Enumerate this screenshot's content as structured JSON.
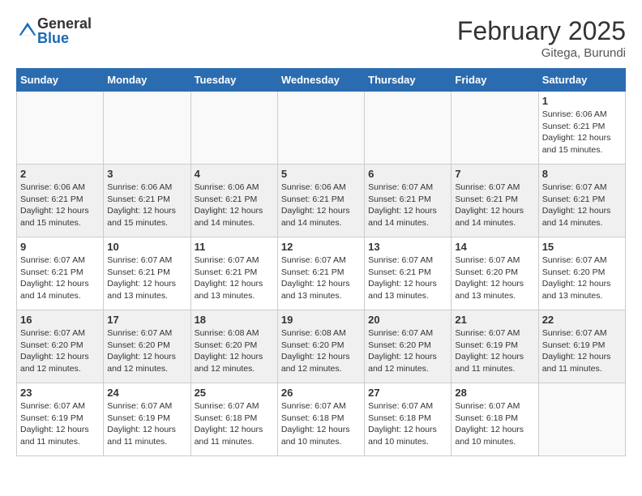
{
  "logo": {
    "general": "General",
    "blue": "Blue"
  },
  "title": {
    "month": "February 2025",
    "location": "Gitega, Burundi"
  },
  "weekdays": [
    "Sunday",
    "Monday",
    "Tuesday",
    "Wednesday",
    "Thursday",
    "Friday",
    "Saturday"
  ],
  "weeks": [
    [
      {
        "day": "",
        "info": ""
      },
      {
        "day": "",
        "info": ""
      },
      {
        "day": "",
        "info": ""
      },
      {
        "day": "",
        "info": ""
      },
      {
        "day": "",
        "info": ""
      },
      {
        "day": "",
        "info": ""
      },
      {
        "day": "1",
        "info": "Sunrise: 6:06 AM\nSunset: 6:21 PM\nDaylight: 12 hours\nand 15 minutes."
      }
    ],
    [
      {
        "day": "2",
        "info": "Sunrise: 6:06 AM\nSunset: 6:21 PM\nDaylight: 12 hours\nand 15 minutes."
      },
      {
        "day": "3",
        "info": "Sunrise: 6:06 AM\nSunset: 6:21 PM\nDaylight: 12 hours\nand 15 minutes."
      },
      {
        "day": "4",
        "info": "Sunrise: 6:06 AM\nSunset: 6:21 PM\nDaylight: 12 hours\nand 14 minutes."
      },
      {
        "day": "5",
        "info": "Sunrise: 6:06 AM\nSunset: 6:21 PM\nDaylight: 12 hours\nand 14 minutes."
      },
      {
        "day": "6",
        "info": "Sunrise: 6:07 AM\nSunset: 6:21 PM\nDaylight: 12 hours\nand 14 minutes."
      },
      {
        "day": "7",
        "info": "Sunrise: 6:07 AM\nSunset: 6:21 PM\nDaylight: 12 hours\nand 14 minutes."
      },
      {
        "day": "8",
        "info": "Sunrise: 6:07 AM\nSunset: 6:21 PM\nDaylight: 12 hours\nand 14 minutes."
      }
    ],
    [
      {
        "day": "9",
        "info": "Sunrise: 6:07 AM\nSunset: 6:21 PM\nDaylight: 12 hours\nand 14 minutes."
      },
      {
        "day": "10",
        "info": "Sunrise: 6:07 AM\nSunset: 6:21 PM\nDaylight: 12 hours\nand 13 minutes."
      },
      {
        "day": "11",
        "info": "Sunrise: 6:07 AM\nSunset: 6:21 PM\nDaylight: 12 hours\nand 13 minutes."
      },
      {
        "day": "12",
        "info": "Sunrise: 6:07 AM\nSunset: 6:21 PM\nDaylight: 12 hours\nand 13 minutes."
      },
      {
        "day": "13",
        "info": "Sunrise: 6:07 AM\nSunset: 6:21 PM\nDaylight: 12 hours\nand 13 minutes."
      },
      {
        "day": "14",
        "info": "Sunrise: 6:07 AM\nSunset: 6:20 PM\nDaylight: 12 hours\nand 13 minutes."
      },
      {
        "day": "15",
        "info": "Sunrise: 6:07 AM\nSunset: 6:20 PM\nDaylight: 12 hours\nand 13 minutes."
      }
    ],
    [
      {
        "day": "16",
        "info": "Sunrise: 6:07 AM\nSunset: 6:20 PM\nDaylight: 12 hours\nand 12 minutes."
      },
      {
        "day": "17",
        "info": "Sunrise: 6:07 AM\nSunset: 6:20 PM\nDaylight: 12 hours\nand 12 minutes."
      },
      {
        "day": "18",
        "info": "Sunrise: 6:08 AM\nSunset: 6:20 PM\nDaylight: 12 hours\nand 12 minutes."
      },
      {
        "day": "19",
        "info": "Sunrise: 6:08 AM\nSunset: 6:20 PM\nDaylight: 12 hours\nand 12 minutes."
      },
      {
        "day": "20",
        "info": "Sunrise: 6:07 AM\nSunset: 6:20 PM\nDaylight: 12 hours\nand 12 minutes."
      },
      {
        "day": "21",
        "info": "Sunrise: 6:07 AM\nSunset: 6:19 PM\nDaylight: 12 hours\nand 11 minutes."
      },
      {
        "day": "22",
        "info": "Sunrise: 6:07 AM\nSunset: 6:19 PM\nDaylight: 12 hours\nand 11 minutes."
      }
    ],
    [
      {
        "day": "23",
        "info": "Sunrise: 6:07 AM\nSunset: 6:19 PM\nDaylight: 12 hours\nand 11 minutes."
      },
      {
        "day": "24",
        "info": "Sunrise: 6:07 AM\nSunset: 6:19 PM\nDaylight: 12 hours\nand 11 minutes."
      },
      {
        "day": "25",
        "info": "Sunrise: 6:07 AM\nSunset: 6:18 PM\nDaylight: 12 hours\nand 11 minutes."
      },
      {
        "day": "26",
        "info": "Sunrise: 6:07 AM\nSunset: 6:18 PM\nDaylight: 12 hours\nand 10 minutes."
      },
      {
        "day": "27",
        "info": "Sunrise: 6:07 AM\nSunset: 6:18 PM\nDaylight: 12 hours\nand 10 minutes."
      },
      {
        "day": "28",
        "info": "Sunrise: 6:07 AM\nSunset: 6:18 PM\nDaylight: 12 hours\nand 10 minutes."
      },
      {
        "day": "",
        "info": ""
      }
    ]
  ]
}
